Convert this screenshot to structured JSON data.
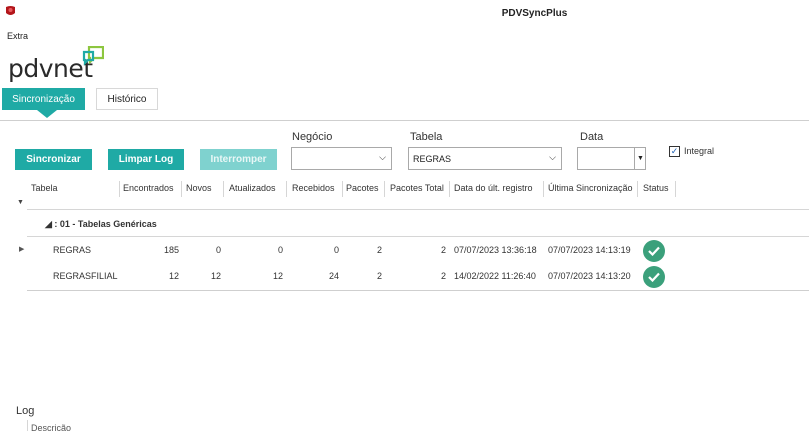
{
  "window": {
    "title": "PDVSyncPlus"
  },
  "menu": {
    "extra": "Extra"
  },
  "brand": {
    "logo_text": "pdvnet",
    "accent": "#1faaa5",
    "bubble_green": "#8dc63f",
    "bubble_blue": "#1faaa5"
  },
  "tabs": [
    {
      "label": "Sincronização",
      "active": true
    },
    {
      "label": "Histórico",
      "active": false
    }
  ],
  "toolbar": {
    "sync_label": "Sincronizar",
    "clear_label": "Limpar Log",
    "stop_label": "Interromper",
    "stop_enabled": false
  },
  "filters": {
    "negocio_label": "Negócio",
    "negocio_value": "",
    "tabela_label": "Tabela",
    "tabela_value": "REGRAS",
    "data_label": "Data",
    "data_value": "",
    "integral_label": "Integral",
    "integral_checked": true
  },
  "grid": {
    "columns": [
      "Tabela",
      "Encontrados",
      "Novos",
      "Atualizados",
      "Recebidos",
      "Pacotes",
      "Pacotes Total",
      "Data do últ. registro",
      "Última Sincronização",
      "Status"
    ],
    "group_label": "◢ : 01 - Tabelas Genéricas",
    "rows": [
      {
        "tabela": "REGRAS",
        "encontrados": "185",
        "novos": "0",
        "atualizados": "0",
        "recebidos": "0",
        "pacotes": "2",
        "pacotes_total": "2",
        "data_ult_registro": "07/07/2023 13:36:18",
        "ultima_sincronizacao": "07/07/2023 14:13:19",
        "status": "ok"
      },
      {
        "tabela": "REGRASFILIAL",
        "encontrados": "12",
        "novos": "12",
        "atualizados": "12",
        "recebidos": "24",
        "pacotes": "2",
        "pacotes_total": "2",
        "data_ult_registro": "14/02/2022 11:26:40",
        "ultima_sincronizacao": "07/07/2023 14:13:20",
        "status": "ok"
      }
    ],
    "status_color": "#3ba07b"
  },
  "log": {
    "title": "Log",
    "column": "Descrição"
  }
}
